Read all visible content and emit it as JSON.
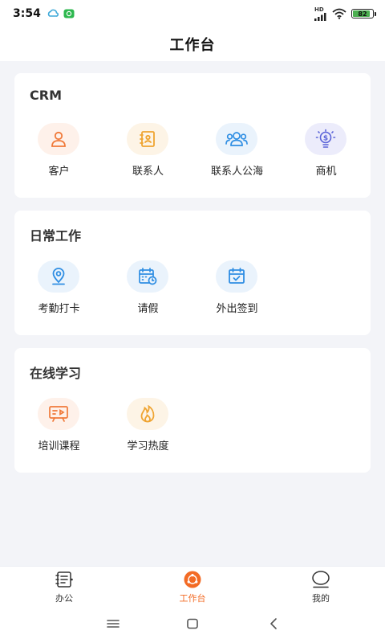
{
  "status_bar": {
    "time": "3:54",
    "network_label": "HD",
    "battery_level": "82",
    "battery_fraction": 0.82
  },
  "header": {
    "title": "工作台"
  },
  "sections": [
    {
      "title": "CRM",
      "items": [
        {
          "label": "客户",
          "icon": "customer-icon",
          "bg": "#fef1ea",
          "color": "#f07a3a"
        },
        {
          "label": "联系人",
          "icon": "contact-card-icon",
          "bg": "#fdf4e6",
          "color": "#efa431"
        },
        {
          "label": "联系人公海",
          "icon": "contact-group-icon",
          "bg": "#eaf3fc",
          "color": "#2f8ee3"
        },
        {
          "label": "商机",
          "icon": "opportunity-bulb-icon",
          "bg": "#ececfb",
          "color": "#5a63d8"
        }
      ]
    },
    {
      "title": "日常工作",
      "items": [
        {
          "label": "考勤打卡",
          "icon": "location-checkin-icon",
          "bg": "#eaf3fc",
          "color": "#2f8ee3"
        },
        {
          "label": "请假",
          "icon": "calendar-clock-icon",
          "bg": "#eaf3fc",
          "color": "#2f8ee3"
        },
        {
          "label": "外出签到",
          "icon": "calendar-check-icon",
          "bg": "#eaf3fc",
          "color": "#2f8ee3"
        }
      ]
    },
    {
      "title": "在线学习",
      "items": [
        {
          "label": "培训课程",
          "icon": "course-board-icon",
          "bg": "#fef1ea",
          "color": "#f07a3a"
        },
        {
          "label": "学习热度",
          "icon": "flame-icon",
          "bg": "#fdf4e6",
          "color": "#efa431"
        }
      ]
    }
  ],
  "tabs": [
    {
      "label": "办公",
      "icon": "office-list-icon",
      "active": false
    },
    {
      "label": "工作台",
      "icon": "workbench-icon",
      "active": true
    },
    {
      "label": "我的",
      "icon": "profile-icon",
      "active": false
    }
  ],
  "colors": {
    "accent": "#f36b25",
    "background": "#f3f4f8",
    "card": "#ffffff"
  }
}
